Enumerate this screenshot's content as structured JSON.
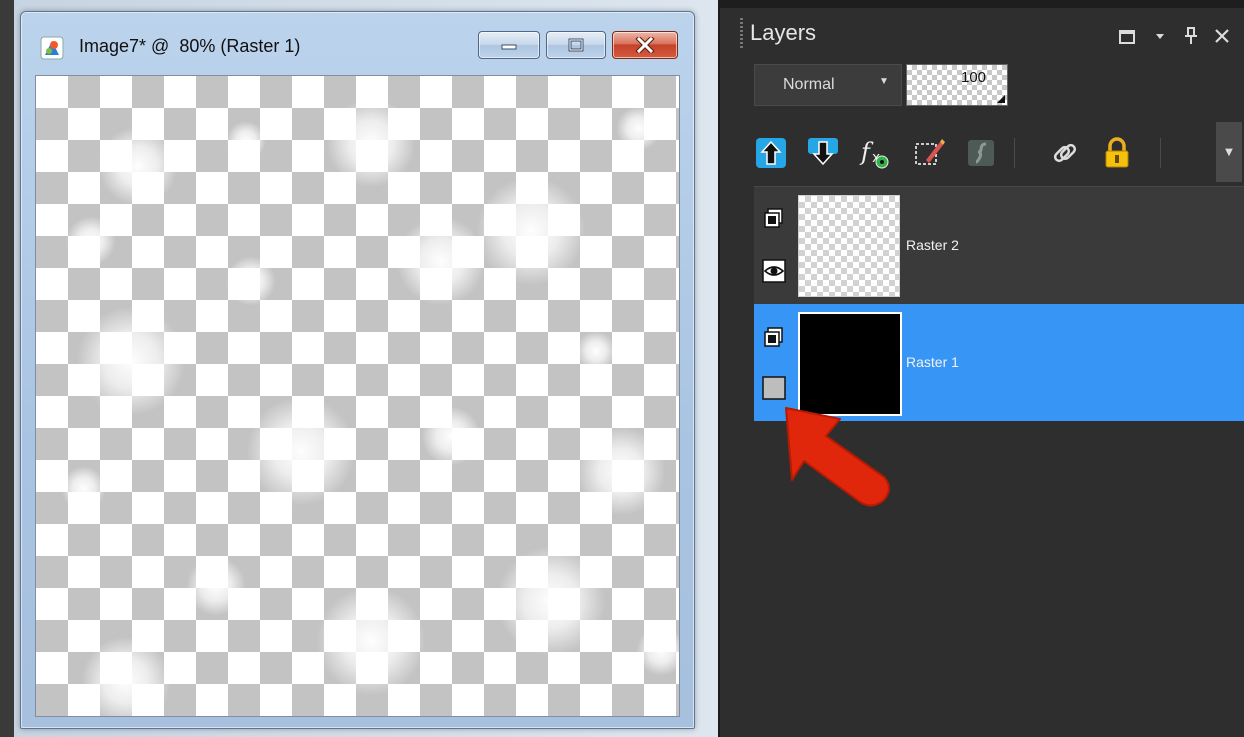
{
  "image_window": {
    "title": "Image7* @  80% (Raster 1)"
  },
  "layers_palette": {
    "title": "Layers",
    "blend_mode": "Normal",
    "opacity": "100",
    "layers": [
      {
        "name": "Raster 2",
        "visible": true,
        "selected": false
      },
      {
        "name": "Raster 1",
        "visible": false,
        "selected": true
      }
    ]
  },
  "colors": {
    "selection": "#3795f5",
    "annotation_arrow": "#e0260b"
  }
}
